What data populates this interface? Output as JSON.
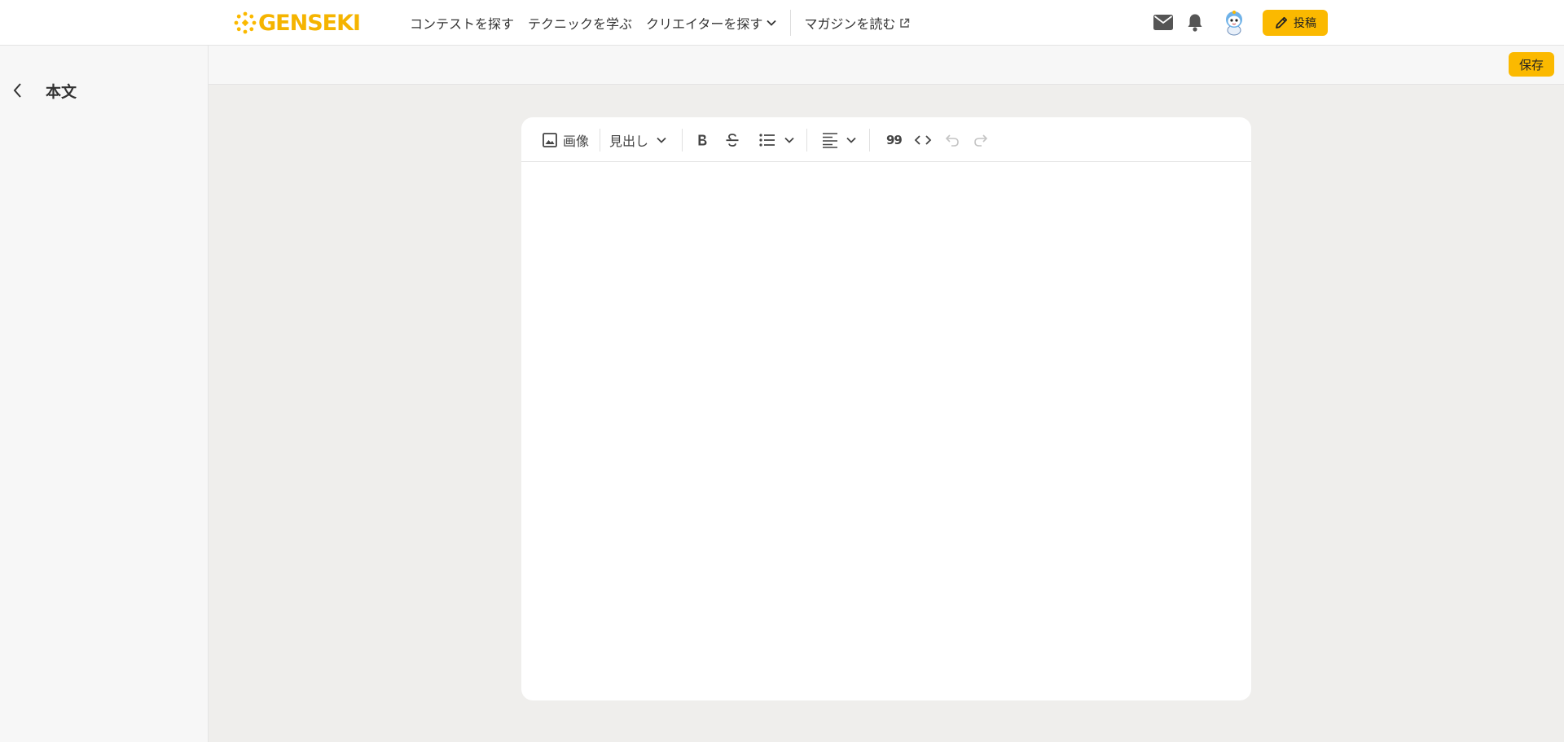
{
  "header": {
    "logo_text": "GENSEKI",
    "brand_color": "#fbb900",
    "nav": [
      {
        "label": "コンテストを探す"
      },
      {
        "label": "テクニックを学ぶ"
      },
      {
        "label": "クリエイターを探す"
      },
      {
        "label": "マガジンを読む"
      }
    ],
    "post_label": "投稿"
  },
  "sidebar": {
    "title": "本文"
  },
  "topbar": {
    "save_label": "保存"
  },
  "editor": {
    "toolbar": {
      "image_label": "画像",
      "heading_label": "見出し",
      "quote_label": "99"
    },
    "content": ""
  },
  "icons": [
    "mail-icon",
    "bell-icon",
    "avatar",
    "pencil-icon",
    "chevron-left-icon",
    "image-icon",
    "bold-icon",
    "strikethrough-icon",
    "list-icon",
    "align-left-icon",
    "code-icon",
    "undo-icon",
    "redo-icon",
    "external-link-icon"
  ]
}
